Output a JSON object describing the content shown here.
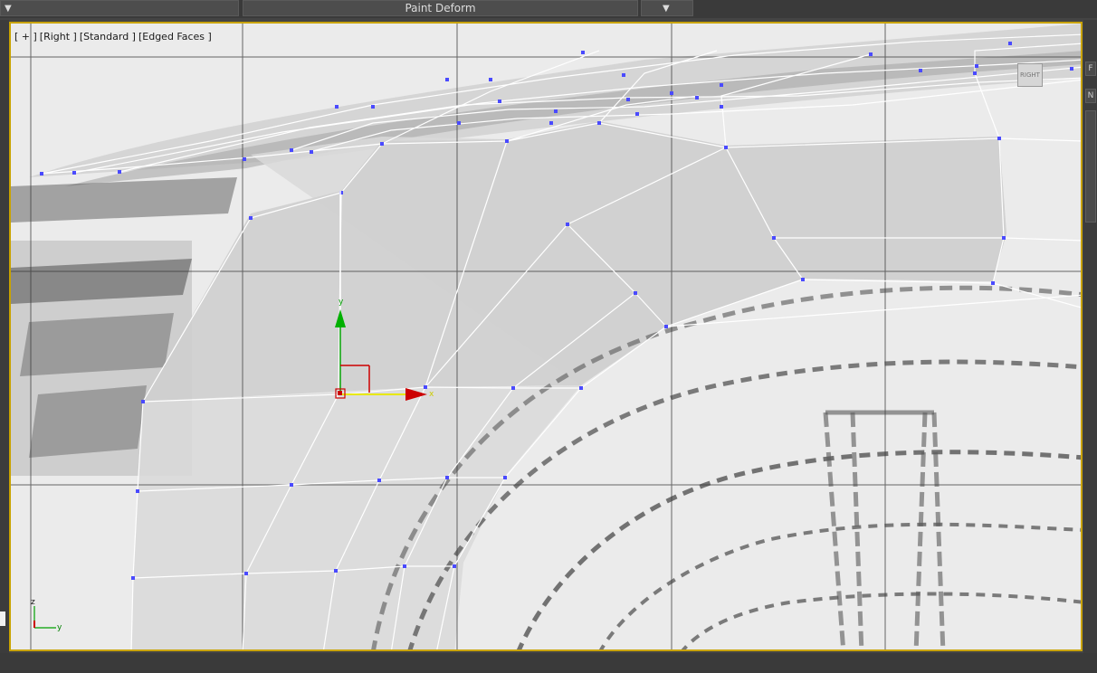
{
  "toolbar": {
    "center_label": "Paint Deform",
    "left_dropdown_icon": "chevron-down-icon",
    "right_dropdown_icon": "chevron-down-icon"
  },
  "viewport": {
    "label_plus": "[ + ]",
    "label_view": "[Right ]",
    "label_shading": "[Standard ]",
    "label_mode": "[Edged Faces ]",
    "viewcube_label": "RIGHT",
    "axis_labels": {
      "y": "y",
      "x": "x",
      "tripod_z": "z",
      "tripod_y": "y"
    }
  },
  "right_panel": {
    "btn1": "F",
    "btn2": "N"
  },
  "colors": {
    "active_border": "#c9a300",
    "vertex": "#4a4aff",
    "gizmo_x": "#cc0000",
    "gizmo_y": "#00a000",
    "gizmo_sel": "#ffff00"
  }
}
